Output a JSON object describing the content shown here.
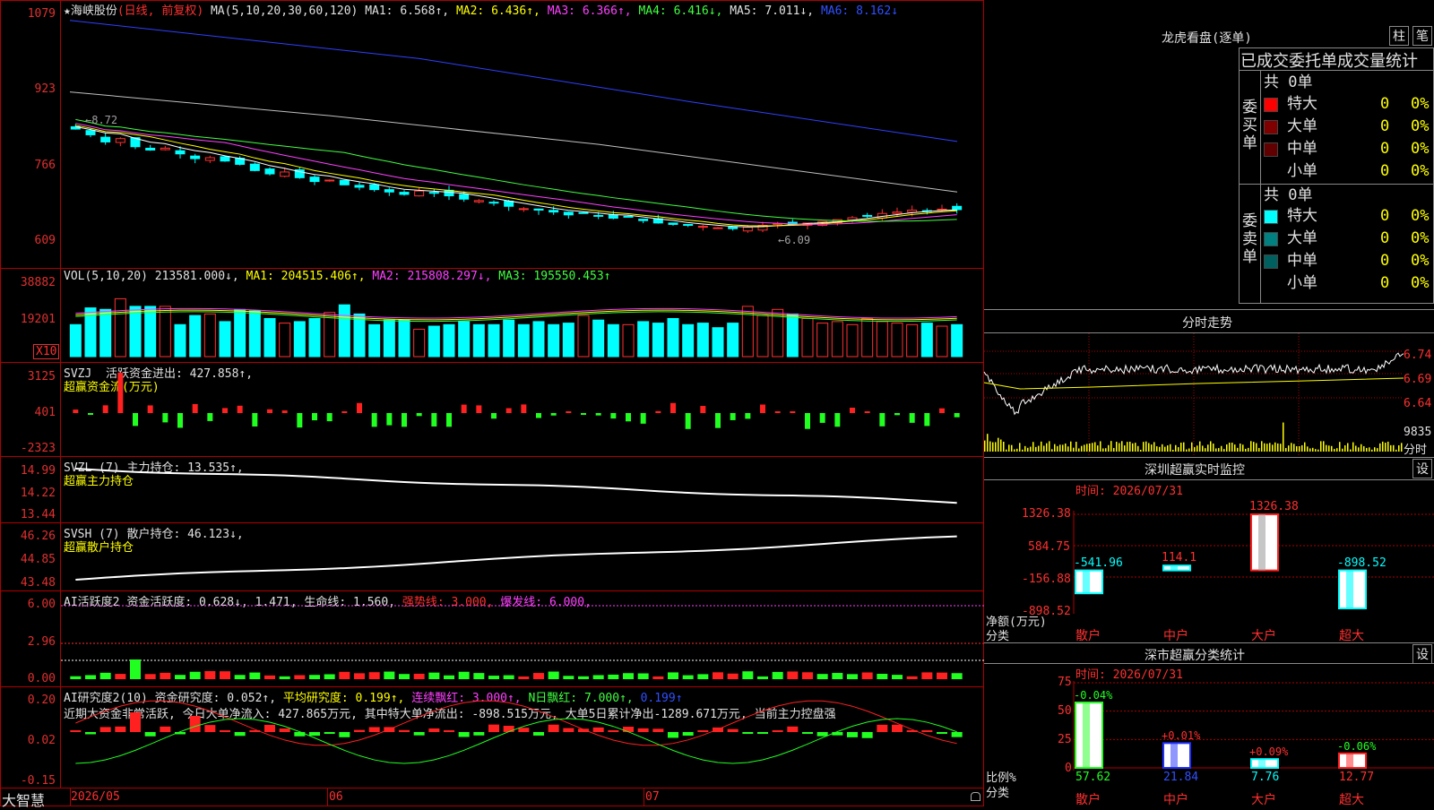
{
  "header": {
    "star": "★",
    "stock_name": "海峡股份",
    "mode": "(日线, 前复权)",
    "ma_label": "MA(5,10,20,30,60,120)",
    "ma1": "MA1: 6.568↑,",
    "ma2": "MA2: 6.436↑,",
    "ma3": "MA3: 6.366↑,",
    "ma4": "MA4: 6.416↓,",
    "ma5": "MA5: 7.011↓,",
    "ma6": "MA6: 8.162↓"
  },
  "price_axis": [
    "1079",
    "923",
    "766",
    "609"
  ],
  "price_annotations": {
    "high": "8.72",
    "low": "6.09"
  },
  "vol_panel": {
    "title": "VOL(5,10,20)",
    "val": "213581.000↓,",
    "ma1": "MA1: 204515.406↑,",
    "ma2": "MA2: 215808.297↓,",
    "ma3": "MA3: 195550.453↑",
    "axis": [
      "38882",
      "19201"
    ],
    "unit": "X10"
  },
  "svzj_panel": {
    "title": "SVZJ",
    "line": "活跃资金进出: 427.858↑,",
    "sub": "超赢资金流(万元)",
    "axis": [
      "3125",
      "401",
      "-2323"
    ]
  },
  "svzl_panel": {
    "title": "SVZL (7)",
    "line": "主力持仓: 13.535↑,",
    "sub": "超赢主力持仓",
    "axis": [
      "14.99",
      "14.22",
      "13.44"
    ]
  },
  "svsh_panel": {
    "title": "SVSH (7)",
    "line": "散户持仓: 46.123↓,",
    "sub": "超赢散户持仓",
    "axis": [
      "46.26",
      "44.85",
      "43.48"
    ]
  },
  "ai1_panel": {
    "title": "AI活跃度2",
    "l1": "资金活跃度: 0.628↓,",
    "l2": "1.471,",
    "l3": "生命线: 1.560,",
    "l4": "强势线: 3.000,",
    "l5": "爆发线: 6.000,",
    "axis": [
      "6.00",
      "2.96",
      "0.00"
    ]
  },
  "ai2_panel": {
    "title": "AI研究度2(10)",
    "l1": "资金研究度: 0.052↑,",
    "l2": "平均研究度: 0.199↑,",
    "l3": "连续飘红: 3.000↑,",
    "l4": "N日飘红: 7.000↑,",
    "l5": "0.199↑",
    "comment": "近期大资金非常活跃, 今日大单净流入: 427.865万元, 其中特大单净流出: -898.515万元, 大单5日累计净出-1289.671万元, 当前主力控盘强",
    "axis": [
      "0.20",
      "0.02",
      "-0.15"
    ]
  },
  "footer": {
    "brand": "大智慧",
    "dates": [
      "2026/05",
      "06",
      "07"
    ]
  },
  "lhb": {
    "title": "龙虎看盘(逐单)",
    "btn1": "柱",
    "btn2": "笔",
    "subtitle": "已成交委托单成交量统计",
    "buy_label": "委买单",
    "sell_label": "委卖单",
    "buy_total": "共 0单",
    "sell_total": "共 0单",
    "rows": [
      {
        "name": "特大",
        "count": "0",
        "pct": "0%"
      },
      {
        "name": "大单",
        "count": "0",
        "pct": "0%"
      },
      {
        "name": "中单",
        "count": "0",
        "pct": "0%"
      },
      {
        "name": "小单",
        "count": "0",
        "pct": "0%"
      }
    ],
    "buy_colors": [
      "#ff0000",
      "#800000",
      "#600000",
      "#000000"
    ],
    "sell_colors": [
      "#00ffff",
      "#008080",
      "#006060",
      "#000000"
    ]
  },
  "fenshi": {
    "title": "分时走势",
    "axis": [
      "6.74",
      "6.69",
      "6.64"
    ],
    "vol_label": "9835",
    "vol_unit": "分时"
  },
  "sz_monitor": {
    "title": "深圳超赢实时监控",
    "btn": "设",
    "time": "时间: 2026/07/31",
    "axis": [
      "1326.38",
      "584.75",
      "-156.88",
      "-898.52"
    ],
    "ylabel": "净额(万元)",
    "xlabel": "分类",
    "categories": [
      "散户",
      "中户",
      "大户",
      "超大"
    ],
    "values": [
      "-541.96",
      "114.1",
      "1326.38",
      "-898.52"
    ]
  },
  "sz_class": {
    "title": "深市超赢分类统计",
    "btn": "设",
    "time": "时间: 2026/07/31",
    "axis": [
      "75",
      "50",
      "25",
      "0"
    ],
    "ylabel": "比例%",
    "xlabel": "分类",
    "categories": [
      "散户",
      "中户",
      "大户",
      "超大"
    ],
    "values": [
      "57.62",
      "21.84",
      "7.76",
      "12.77"
    ],
    "changes": [
      "-0.04%",
      "+0.01%",
      "+0.09%",
      "-0.06%"
    ]
  },
  "chart_data": [
    {
      "type": "candlestick",
      "title": "海峡股份 (日线, 前复权)",
      "x": [
        "2026/05",
        "06",
        "07"
      ],
      "ylim": [
        6.09,
        10.79
      ],
      "close": [
        8.42,
        8.3,
        8.15,
        8.22,
        8.05,
        7.98,
        8.02,
        7.9,
        7.8,
        7.82,
        7.75,
        7.68,
        7.55,
        7.48,
        7.52,
        7.4,
        7.32,
        7.35,
        7.25,
        7.2,
        7.15,
        7.1,
        7.05,
        7.12,
        7.08,
        7.02,
        6.95,
        6.92,
        6.88,
        6.8,
        6.75,
        6.72,
        6.68,
        6.62,
        6.65,
        6.6,
        6.55,
        6.58,
        6.5,
        6.45,
        6.42,
        6.4,
        6.38,
        6.35,
        6.33,
        6.36,
        6.4,
        6.44,
        6.42,
        6.45,
        6.48,
        6.52,
        6.56,
        6.6,
        6.65,
        6.68,
        6.72,
        6.7,
        6.74,
        6.73
      ],
      "ma_values": {
        "MA1": 6.568,
        "MA2": 6.436,
        "MA3": 6.366,
        "MA4": 6.416,
        "MA5": 7.011,
        "MA6": 8.162
      }
    },
    {
      "type": "bar",
      "title": "VOL(5,10,20)",
      "values": [
        21,
        32,
        31,
        38,
        33,
        33,
        33,
        21,
        27,
        28,
        23,
        31,
        30,
        25,
        22,
        23,
        25,
        29,
        34,
        28,
        21,
        24,
        24,
        18,
        20,
        21,
        23,
        21,
        21,
        24,
        21,
        23,
        21,
        22,
        27,
        24,
        21,
        21,
        23,
        22,
        25,
        21,
        22,
        19,
        22,
        33,
        27,
        31,
        28,
        25,
        22,
        23,
        21,
        25,
        23,
        22,
        21,
        22,
        20,
        21
      ]
    },
    {
      "type": "bar",
      "title": "SVZJ 超赢资金流(万元)",
      "ylim": [
        -2323,
        3125
      ]
    },
    {
      "type": "bar",
      "title": "深圳超赢实时监控",
      "categories": [
        "散户",
        "中户",
        "大户",
        "超大"
      ],
      "values": [
        -541.96,
        114.1,
        1326.38,
        -898.52
      ]
    },
    {
      "type": "bar",
      "title": "深市超赢分类统计",
      "categories": [
        "散户",
        "中户",
        "大户",
        "超大"
      ],
      "values": [
        57.62,
        21.84,
        7.76,
        12.77
      ]
    }
  ]
}
